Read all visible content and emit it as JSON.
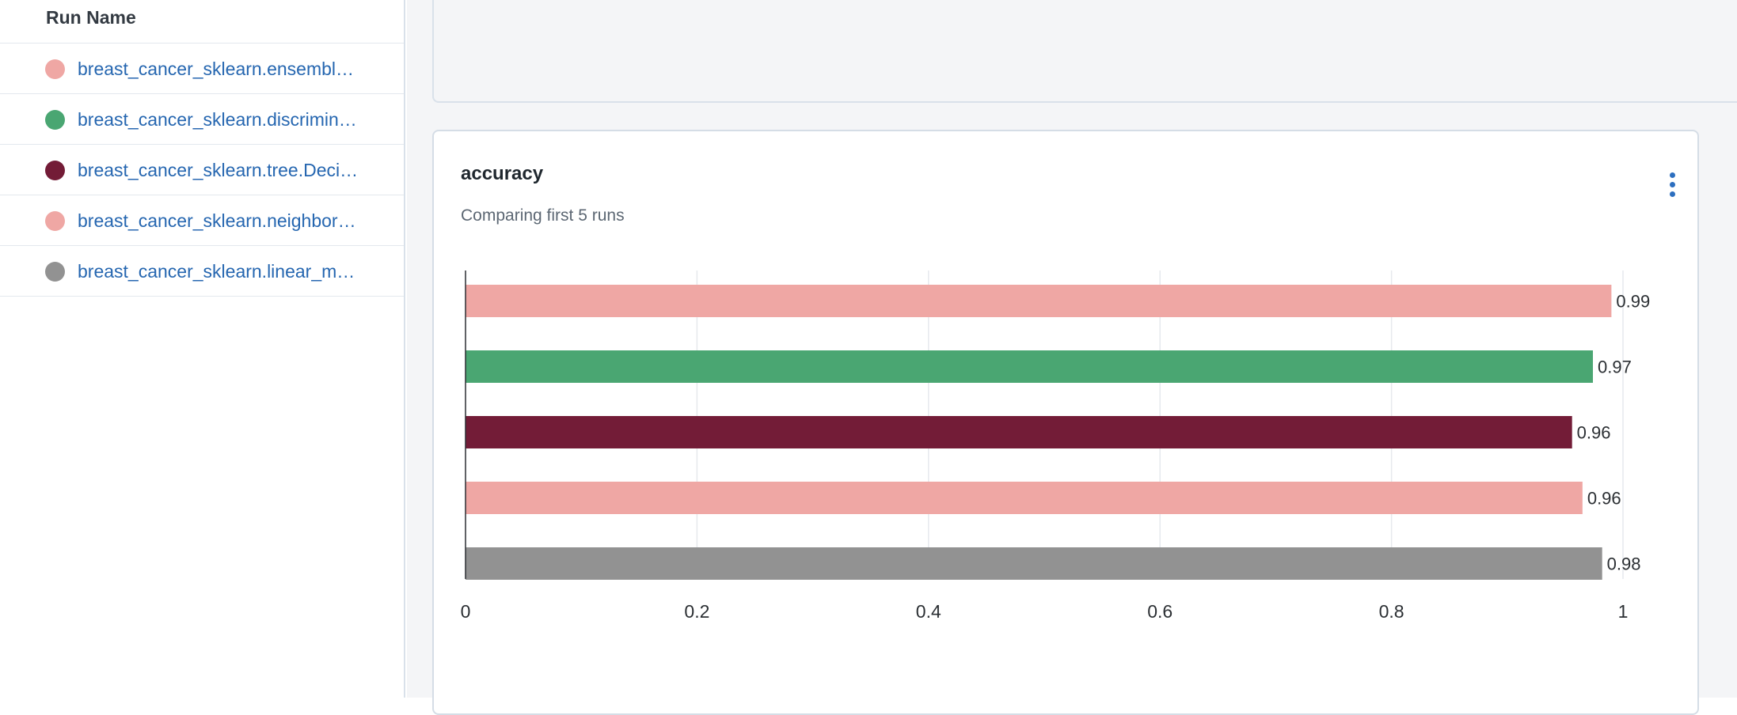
{
  "runs_panel": {
    "header": "Run Name",
    "runs": [
      {
        "name": "breast_cancer_sklearn.ensembl…",
        "color": "#efa7a4"
      },
      {
        "name": "breast_cancer_sklearn.discrimin…",
        "color": "#4aa672"
      },
      {
        "name": "breast_cancer_sklearn.tree.Deci…",
        "color": "#731c37"
      },
      {
        "name": "breast_cancer_sklearn.neighbor…",
        "color": "#efa7a4"
      },
      {
        "name": "breast_cancer_sklearn.linear_m…",
        "color": "#929292"
      }
    ]
  },
  "chart_card": {
    "title": "accuracy",
    "subtitle": "Comparing first 5 runs",
    "menu_icon": "more-vertical-icon"
  },
  "chart_data": {
    "type": "bar",
    "orientation": "horizontal",
    "categories": [
      "breast_cancer_sklearn.ensembl…",
      "breast_cancer_sklearn.discrimin…",
      "breast_cancer_sklearn.tree.Deci…",
      "breast_cancer_sklearn.neighbor…",
      "breast_cancer_sklearn.linear_m…"
    ],
    "values": [
      0.99,
      0.974,
      0.956,
      0.965,
      0.982
    ],
    "value_labels": [
      "0.99",
      "0.97",
      "0.96",
      "0.96",
      "0.98"
    ],
    "colors": [
      "#efa7a4",
      "#4aa672",
      "#731c37",
      "#efa7a4",
      "#929292"
    ],
    "xlim": [
      0,
      1
    ],
    "xticks": [
      0,
      0.2,
      0.4,
      0.6,
      0.8,
      1
    ],
    "xtick_labels": [
      "0",
      "0.2",
      "0.4",
      "0.6",
      "0.8",
      "1"
    ],
    "grid": true,
    "title": "",
    "xlabel": "",
    "ylabel": ""
  }
}
